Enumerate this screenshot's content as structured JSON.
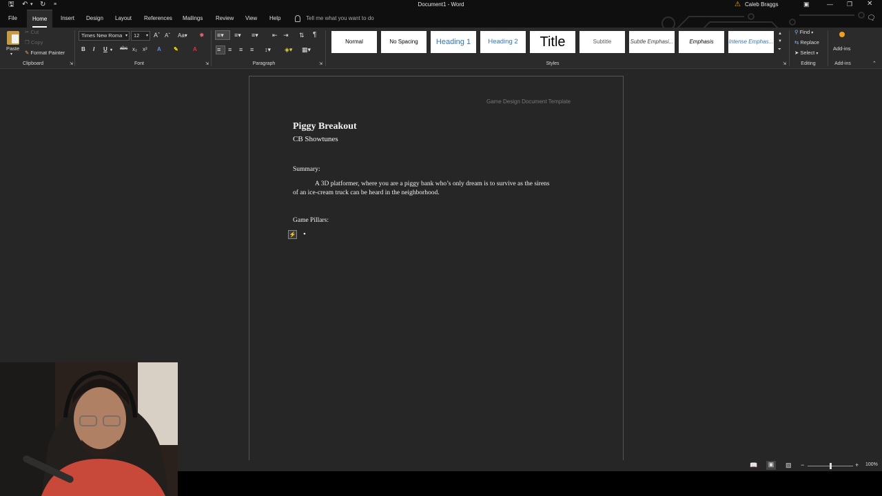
{
  "window": {
    "title": "Document1 - Word",
    "user_name": "Caleb Braggs"
  },
  "tabs": [
    "File",
    "Home",
    "Insert",
    "Design",
    "Layout",
    "References",
    "Mailings",
    "Review",
    "View",
    "Help"
  ],
  "active_tab": "Home",
  "tell_me": "Tell me what you want to do",
  "clipboard": {
    "paste": "Paste",
    "cut": "Cut",
    "copy": "Copy",
    "format_painter": "Format Painter",
    "label": "Clipboard"
  },
  "font": {
    "name": "Times New Roma",
    "size": "12",
    "label": "Font"
  },
  "paragraph": {
    "label": "Paragraph"
  },
  "styles": {
    "label": "Styles",
    "items": [
      "Normal",
      "No Spacing",
      "Heading 1",
      "Heading 2",
      "Title",
      "Subtitle",
      "Subtle Emphasi...",
      "Emphasis",
      "Intense Emphas..."
    ]
  },
  "editing": {
    "find": "Find",
    "replace": "Replace",
    "select": "Select",
    "label": "Editing"
  },
  "addins": {
    "button": "Add-ins",
    "label": "Add-ins"
  },
  "document": {
    "header": "Game Design Document Template",
    "title": "Piggy Breakout",
    "studio": "CB Showtunes",
    "summary_heading": "Summary:",
    "summary_line1": "A 3D platformer, where you are a piggy bank who’s only dream is to survive as the sirens",
    "summary_line2": "of an ice-cream truck can be heard in the neighborhood.",
    "pillars_heading": "Game Pillars:",
    "bullet": "•"
  },
  "status": {
    "zoom": "100%"
  },
  "colors": {
    "accent_addin": "#f0a020",
    "warning": "#f0b400"
  }
}
